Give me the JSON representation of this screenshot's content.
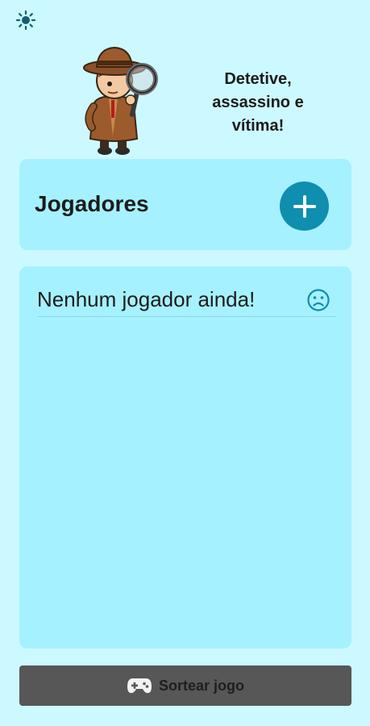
{
  "header": {
    "theme_icon": "sun-icon",
    "mascot_icon": "detective-mascot-icon",
    "app_title": "Detetive,\nassassino e\nvítima!"
  },
  "players": {
    "title": "Jogadores",
    "add_icon": "plus-icon",
    "empty_message": "Nenhum jogador ainda!",
    "empty_icon": "sad-face-icon"
  },
  "footer": {
    "draw_label": "Sortear jogo",
    "draw_icon": "gamepad-icon"
  },
  "colors": {
    "background": "#ccf9ff",
    "card": "#a6f1ff",
    "accent": "#0f8eb0",
    "button_dark": "#575757"
  }
}
